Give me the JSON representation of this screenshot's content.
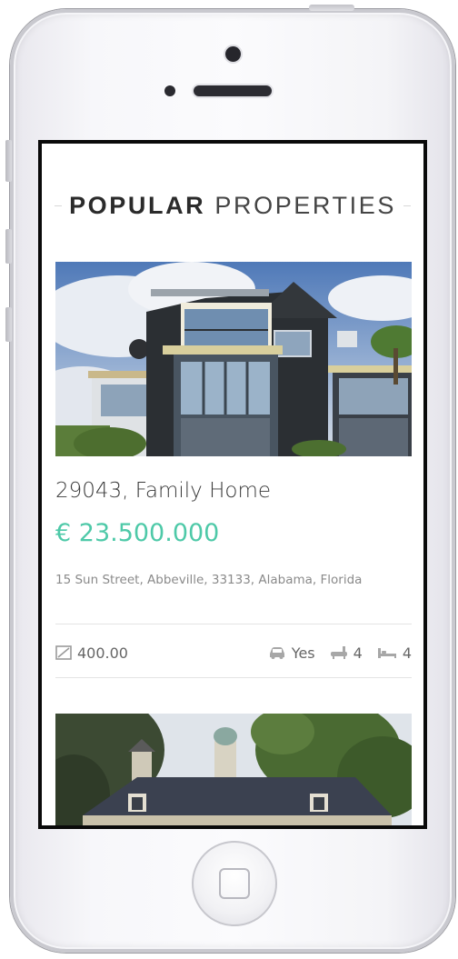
{
  "section": {
    "title_bold": "POPULAR",
    "title_light": "PROPERTIES"
  },
  "properties": [
    {
      "title": "29043, Family Home",
      "price": "€ 23.500.000",
      "address": "15 Sun Street, Abbeville, 33133, Alabama, Florida",
      "area": "400.00",
      "garage": "Yes",
      "bathrooms": "4",
      "bedrooms": "4",
      "photo_icon": "modern-house-photo"
    },
    {
      "photo_icon": "colonial-house-photo"
    }
  ],
  "colors": {
    "accent": "#4ec9a8",
    "heading": "#2b2b2b",
    "phone_body": "#f4f4f7"
  }
}
